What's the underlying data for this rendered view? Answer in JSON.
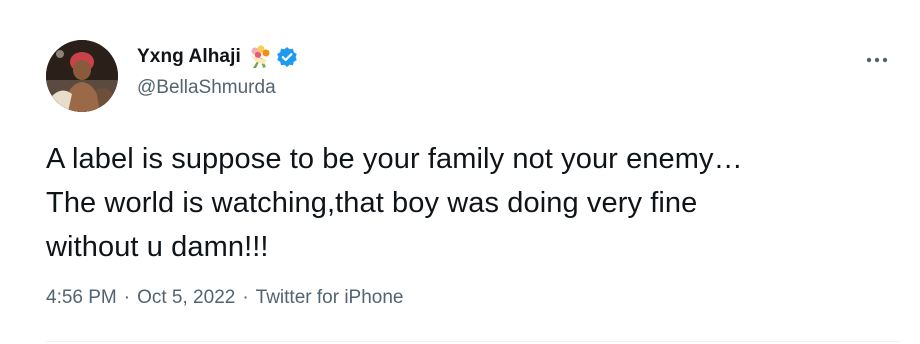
{
  "author": {
    "display_name": "Yxng Alhaji",
    "handle": "@BellaShmurda",
    "emoji_icon": "bouquet-emoji-icon",
    "verified_icon": "verified-badge-icon",
    "verified_color": "#1d9bf0"
  },
  "tweet": {
    "text": "A label is suppose to be your family not your enemy…\nThe world is watching,that boy was doing very fine\nwithout u damn!!!"
  },
  "meta": {
    "time": "4:56 PM",
    "separator": "·",
    "date": "Oct 5, 2022",
    "source": "Twitter for iPhone"
  },
  "actions": {
    "more_icon": "more-options-icon"
  },
  "colors": {
    "text_primary": "#0f1419",
    "text_secondary": "#536471",
    "divider": "#eff3f4"
  }
}
